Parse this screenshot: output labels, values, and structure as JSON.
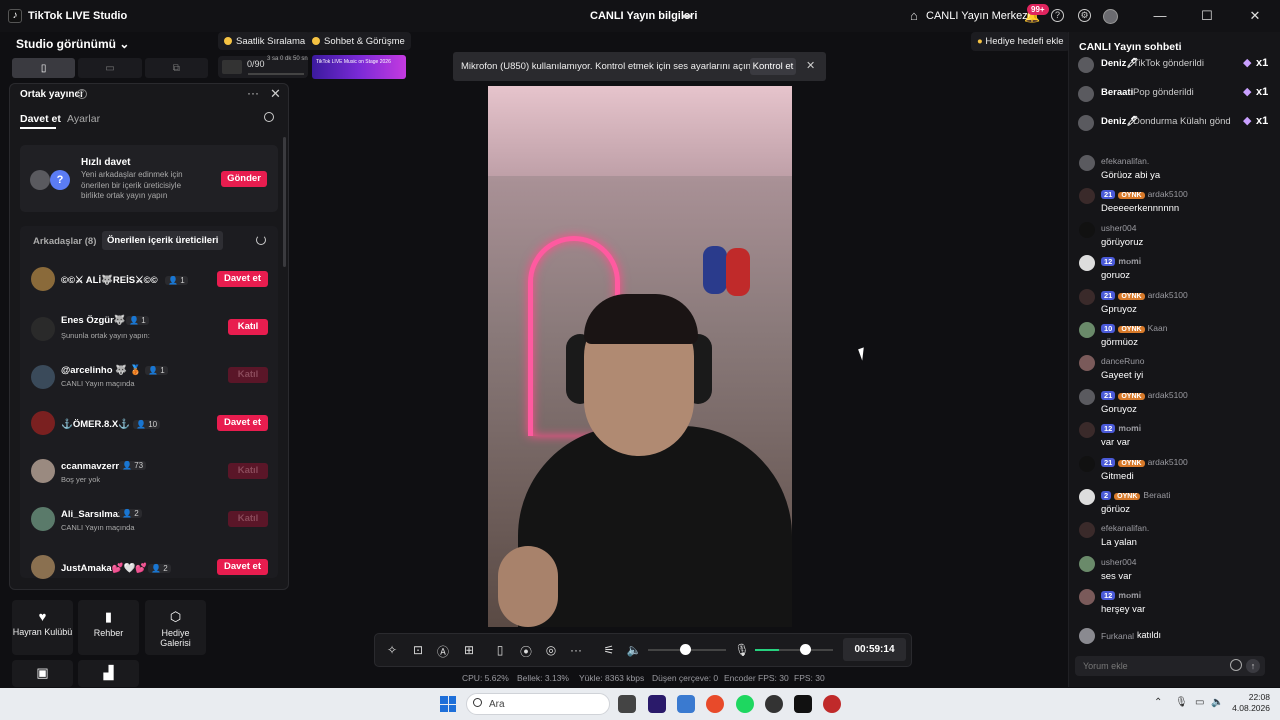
{
  "titlebar": {
    "app_name": "TikTok LIVE Studio",
    "center_title": "CANLI Yayın bilgileri",
    "hub_label": "CANLI Yayın Merkezi",
    "notif_badge": "99+"
  },
  "left": {
    "studio_view": "Studio görünümü",
    "chips": [
      "Saatlik Sıralama",
      "Sohbet & Görüşme"
    ],
    "goal_text": "0/90",
    "goal_sub": "3 sa 0 dk 50 sn",
    "banner_text": "TikTok LIVE Music on Stage 2026",
    "tiles": [
      "Hayran Kulübü",
      "Rehber",
      "Hediye Galerisi"
    ]
  },
  "panel": {
    "title": "Ortak yayıncı",
    "tabs": [
      "Davet et",
      "Ayarlar"
    ],
    "quick": {
      "title": "Hızlı davet",
      "desc": "Yeni arkadaşlar edinmek için önerilen bir içerik üreticisiyle birlikte ortak yayın yapın",
      "button": "Gönder"
    },
    "segments": [
      "Arkadaşlar (8)",
      "Önerilen içerik üreticileri"
    ],
    "rows": [
      {
        "name": "©©⚔ ALİ🐺REİS⚔©©",
        "count": "1",
        "sub": "",
        "action": "Davet et",
        "enabled": true
      },
      {
        "name": "Enes Özgür🐺",
        "count": "1",
        "sub": "Şununla ortak yayın yapın:",
        "action": "Katıl",
        "enabled": true
      },
      {
        "name": "@arcelinho 🐺 🥉",
        "count": "1",
        "sub": "CANLI Yayın maçında",
        "action": "Katıl",
        "enabled": false
      },
      {
        "name": "⚓ÖMER.8.X⚓",
        "count": "10",
        "sub": "",
        "action": "Davet et",
        "enabled": true
      },
      {
        "name": "ccanmavzerr",
        "count": "73",
        "sub": "Boş yer yok",
        "action": "Katıl",
        "enabled": false
      },
      {
        "name": "Ali_Sarsılmaz",
        "count": "2",
        "sub": "CANLI Yayın maçında",
        "action": "Katıl",
        "enabled": false
      },
      {
        "name": "JustAmaka💕🤍💕",
        "count": "2",
        "sub": "",
        "action": "Davet et",
        "enabled": true
      }
    ]
  },
  "notice": {
    "text": "Mikrofon (U850) kullanılamıyor. Kontrol etmek için ses ayarlarını açın.",
    "button": "Kontrol et"
  },
  "gift_goal": "Hediye hedefi ekle",
  "controls": {
    "timer": "00:59:14",
    "volume_level": 0.47,
    "mic_level": 0.64
  },
  "stats": [
    "CPU: 5.62%",
    "Bellek: 3.13%",
    "Yükle: 8363 kbps",
    "Düşen çerçeve: 0",
    "Encoder FPS: 30",
    "FPS: 30"
  ],
  "chat": {
    "title": "CANLI Yayın sohbeti",
    "gifts": [
      {
        "user": "Deniz🖊",
        "text": "TikTok gönderildi",
        "mult": "x1"
      },
      {
        "user": "Beraati",
        "text": "Pop gönderildi",
        "mult": "x1"
      },
      {
        "user": "Deniz🖊",
        "text": "Dondurma Külahı gönd",
        "mult": "x1"
      }
    ],
    "messages": [
      {
        "user": "efekanalifan.",
        "level": "",
        "fan": "",
        "msg": "Görüoz abi ya"
      },
      {
        "user": "ardak5100",
        "level": "21",
        "fan": "OYNK",
        "msg": "Deeeeerkennnnnn"
      },
      {
        "user": "usher004",
        "level": "",
        "fan": "",
        "msg": "görüyoruz"
      },
      {
        "user": "𝐦𝐨𝐦𝐢",
        "level": "12",
        "fan": "",
        "msg": "goruoz"
      },
      {
        "user": "ardak5100",
        "level": "21",
        "fan": "OYNK",
        "msg": "Gpruyoz"
      },
      {
        "user": "Kaan",
        "level": "10",
        "fan": "OYNK",
        "msg": "görmüoz"
      },
      {
        "user": "danceRuno",
        "level": "",
        "fan": "",
        "msg": "Gayeet iyi"
      },
      {
        "user": "ardak5100",
        "level": "21",
        "fan": "OYNK",
        "msg": "Goruyoz"
      },
      {
        "user": "𝐦𝐨𝐦𝐢",
        "level": "12",
        "fan": "",
        "msg": "var var"
      },
      {
        "user": "ardak5100",
        "level": "21",
        "fan": "OYNK",
        "msg": "Gitmedi"
      },
      {
        "user": "Beraati",
        "level": "2",
        "fan": "OYNK",
        "msg": "görüoz"
      },
      {
        "user": "efekanalifan.",
        "level": "",
        "fan": "",
        "msg": "La yalan"
      },
      {
        "user": "usher004",
        "level": "",
        "fan": "",
        "msg": "ses var"
      },
      {
        "user": "𝐦𝐨𝐦𝐢",
        "level": "12",
        "fan": "",
        "msg": "herşey var"
      }
    ],
    "joined_user": "Furkanal",
    "joined_text": "katıldı",
    "input_placeholder": "Yorum ekle"
  },
  "taskbar": {
    "search": "Ara",
    "time": "22:08",
    "date": "4.08.2026"
  }
}
